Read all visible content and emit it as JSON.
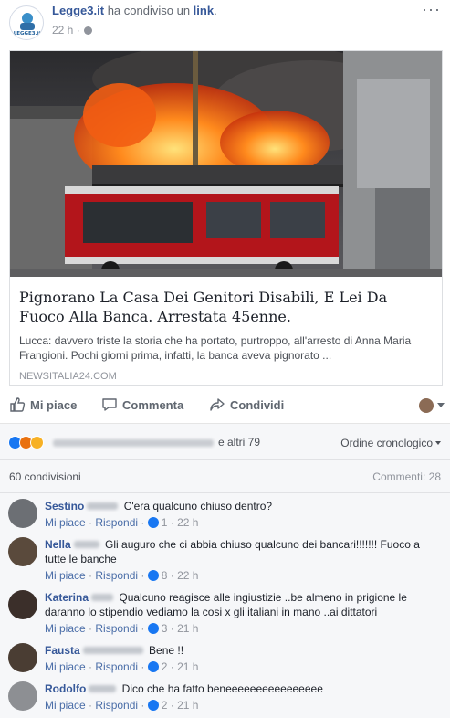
{
  "post": {
    "page_name": "Legge3.it",
    "verb": "ha condiviso un",
    "link_word": "link",
    "time": "22 h",
    "avatar_label": "LEGGE3.it"
  },
  "link_card": {
    "title": "Pignorano La Casa Dei Genitori Disabili, E Lei Da Fuoco Alla Banca. Arrestata 45enne.",
    "description": "Lucca: davvero triste la storia che ha portato, purtroppo, all'arresto di Anna Maria Frangioni. Pochi giorni prima, infatti, la banca aveva pignorato ...",
    "source": "NEWSITALIA24.COM",
    "image_icon": "burning-bank-fire-truck-photo"
  },
  "actions": {
    "like": "Mi piace",
    "comment": "Commenta",
    "share": "Condividi"
  },
  "reactions": {
    "icons": [
      "like-reaction",
      "angry-reaction",
      "sad-reaction"
    ],
    "others": "e altri 79",
    "order": "Ordine cronologico"
  },
  "counts": {
    "shares": "60 condivisioni",
    "comments": "Commenti: 28"
  },
  "comments": [
    {
      "name": "Sestino",
      "text": "C'era qualcuno chiuso dentro?",
      "likes": "1",
      "time": "22 h"
    },
    {
      "name": "Nella",
      "text": "Gli auguro che ci abbia chiuso qualcuno dei bancari!!!!!!! Fuoco a tutte le banche",
      "likes": "8",
      "time": "22 h"
    },
    {
      "name": "Katerina",
      "text": "Qualcuno reagisce alle ingiustizie ..be almeno in prigione le daranno lo stipendio vediamo la cosi x gli italiani in mano ..ai dittatori",
      "likes": "3",
      "time": "21 h"
    },
    {
      "name": "Fausta",
      "text": "Bene !!",
      "likes": "2",
      "time": "21 h"
    },
    {
      "name": "Rodolfo",
      "text": "Dico che ha fatto beneeeeeeeeeeeeeeee",
      "likes": "2",
      "time": "21 h"
    }
  ],
  "comment_actions": {
    "like": "Mi piace",
    "reply": "Rispondi"
  },
  "colors": {
    "link_blue": "#365899",
    "fb_blue": "#1877f2",
    "muted": "#90949c",
    "gray_bg": "#f6f7f9"
  }
}
